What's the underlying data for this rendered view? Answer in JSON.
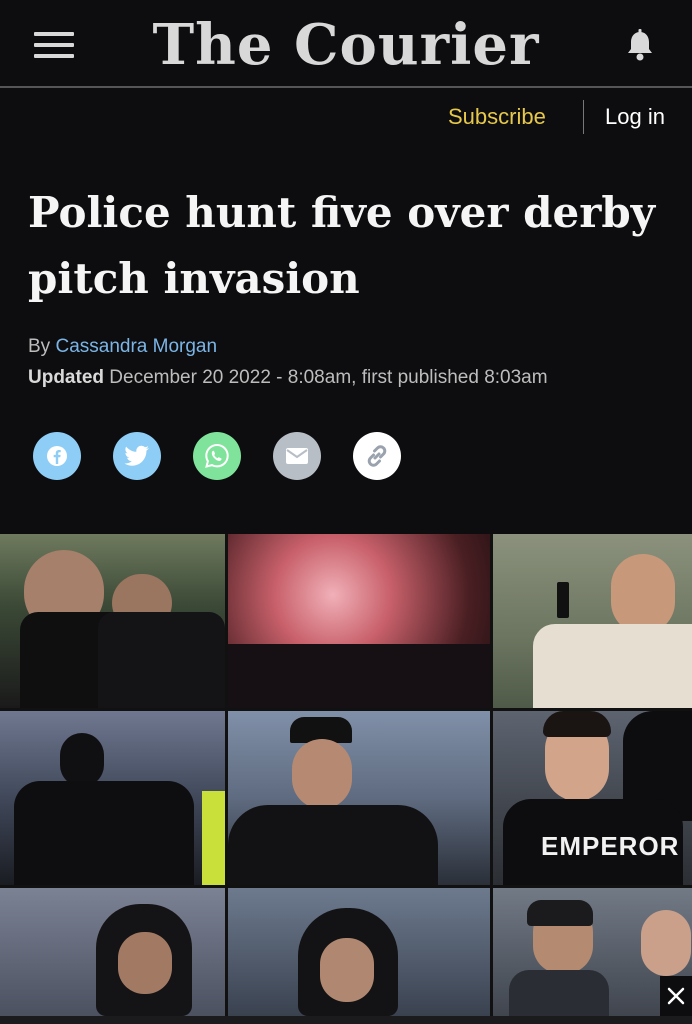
{
  "header": {
    "brand": "The Courier",
    "subscribe_label": "Subscribe",
    "login_label": "Log in"
  },
  "article": {
    "headline": "Police hunt five over derby pitch invasion",
    "by_prefix": "By",
    "author": "Cassandra Morgan",
    "updated_label": "Updated",
    "updated_text": "December 20 2022 - 8:08am, first published 8:03am"
  },
  "share": [
    {
      "network": "facebook",
      "icon": "facebook-icon",
      "color": "#8ecdf5"
    },
    {
      "network": "twitter",
      "icon": "twitter-icon",
      "color": "#8ecdf5"
    },
    {
      "network": "whatsapp",
      "icon": "whatsapp-icon",
      "color": "#7fe39b"
    },
    {
      "network": "email",
      "icon": "email-icon",
      "color": "#b8bec6"
    },
    {
      "network": "copy-link",
      "icon": "link-icon",
      "color": "#ffffff"
    }
  ],
  "hero_image": {
    "shirt_text": "EMPEROR"
  },
  "colors": {
    "background": "#0d0d0f",
    "subscribe": "#e6c84a",
    "author_link": "#7ab5e6"
  }
}
